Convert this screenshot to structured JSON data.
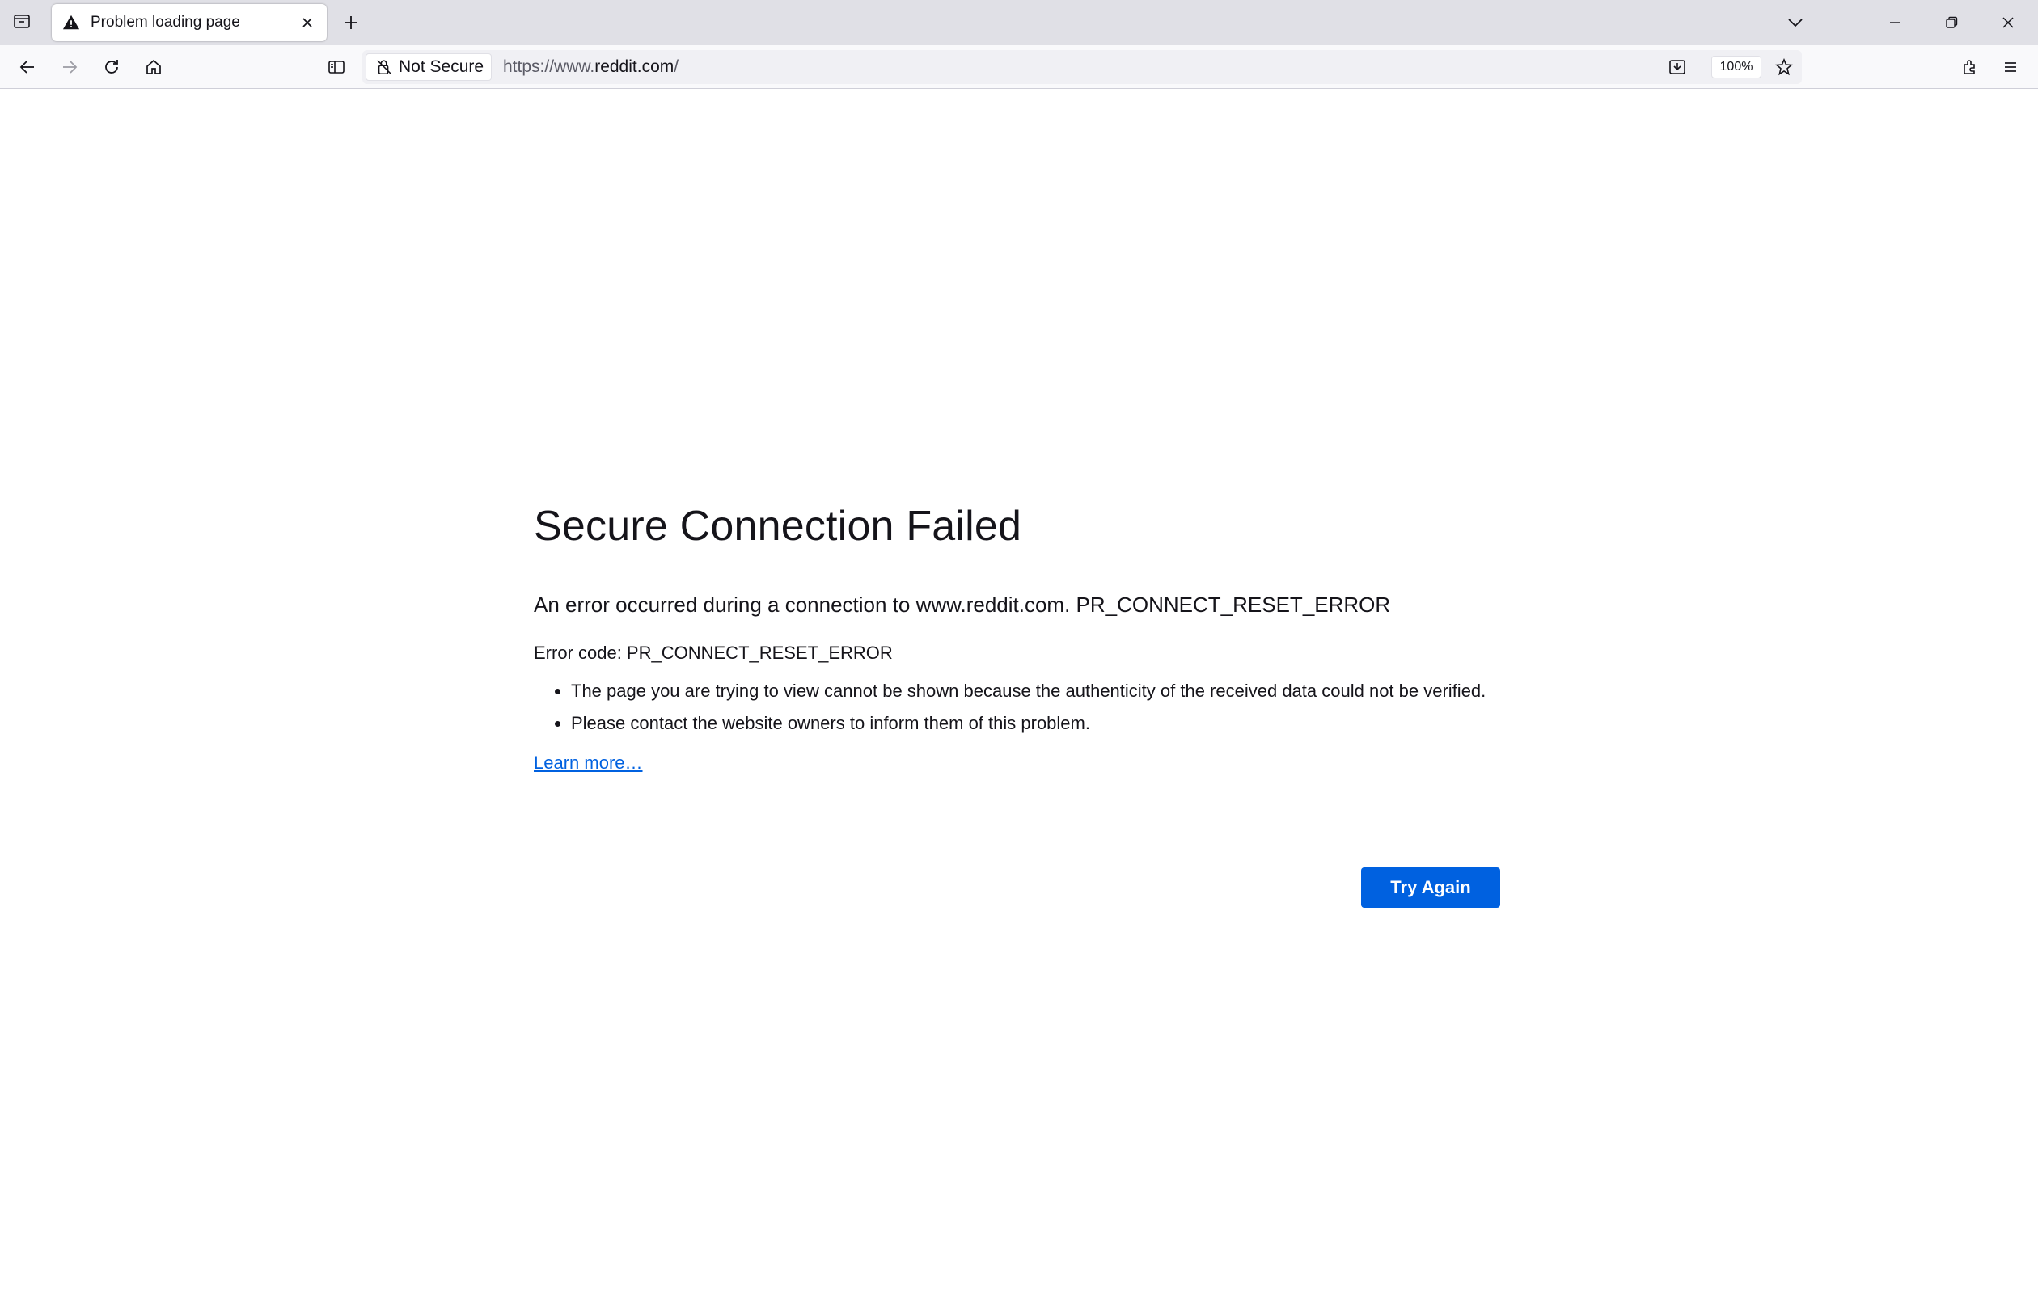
{
  "tab": {
    "title": "Problem loading page",
    "icon": "warning-icon"
  },
  "urlbar": {
    "identity_label": "Not Secure",
    "url_prefix": "https://www.",
    "url_host": "reddit.com",
    "url_suffix": "/",
    "zoom": "100%"
  },
  "error": {
    "title": "Secure Connection Failed",
    "short_desc": "An error occurred during a connection to www.reddit.com. PR_CONNECT_RESET_ERROR",
    "code": "Error code: PR_CONNECT_RESET_ERROR",
    "bullets": [
      "The page you are trying to view cannot be shown because the authenticity of the received data could not be verified.",
      "Please contact the website owners to inform them of this problem."
    ],
    "learn_more": "Learn more…",
    "try_again": "Try Again"
  },
  "colors": {
    "accent": "#0061e0",
    "tabstrip_bg": "#e0e0e6",
    "navbar_bg": "#f9f9fb",
    "urlbar_bg": "#f0f0f4",
    "text": "#15141a"
  }
}
